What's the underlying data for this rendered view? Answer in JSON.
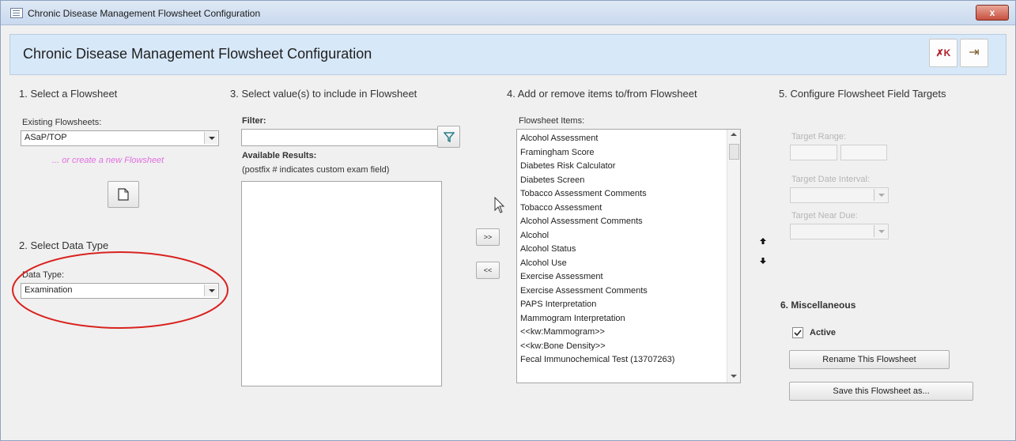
{
  "window": {
    "title": "Chronic Disease Management Flowsheet Configuration",
    "close_label": "x"
  },
  "header": {
    "title": "Chronic Disease Management Flowsheet Configuration",
    "delete_icon_label": "✗K",
    "exit_icon_label": "⇥"
  },
  "section1": {
    "title": "1. Select a  Flowsheet",
    "existing_label": "Existing Flowsheets:",
    "existing_value": "ASaP/TOP",
    "create_link": "... or create a new  Flowsheet"
  },
  "section2": {
    "title": "2. Select Data Type",
    "data_type_label": "Data Type:",
    "data_type_value": "Examination"
  },
  "section3": {
    "title": "3. Select value(s) to include in Flowsheet",
    "filter_label": "Filter:",
    "filter_value": "",
    "available_label": "Available Results:",
    "available_note": "(postfix # indicates custom exam field)"
  },
  "section4": {
    "title": "4. Add or remove items to/from Flowsheet",
    "items_label": "Flowsheet Items:",
    "add_label": ">>",
    "remove_label": "<<",
    "items": [
      "Alcohol Assessment",
      "Framingham Score",
      "Diabetes Risk Calculator",
      "Diabetes Screen",
      "Tobacco Assessment Comments",
      "Tobacco Assessment",
      "Alcohol Assessment Comments",
      "Alcohol",
      "Alcohol Status",
      "Alcohol Use",
      "Exercise Assessment",
      "Exercise Assessment Comments",
      "PAPS Interpretation",
      "Mammogram Interpretation",
      "<<kw:Mammogram>>",
      "<<kw:Bone Density>>",
      "Fecal Immunochemical Test (13707263)"
    ]
  },
  "section5": {
    "title": "5. Configure Flowsheet Field Targets",
    "target_range": "Target Range:",
    "target_date_interval": "Target Date Interval:",
    "target_near_due": "Target Near Due:"
  },
  "section6": {
    "title": "6. Miscellaneous",
    "active_label": "Active",
    "active_checked": true,
    "rename_label": "Rename This Flowsheet",
    "save_as_label": "Save this Flowsheet as..."
  },
  "colors": {
    "link": "#e070e0",
    "highlight_ellipse": "#d9231f",
    "header_bg": "#d7e8f8"
  }
}
